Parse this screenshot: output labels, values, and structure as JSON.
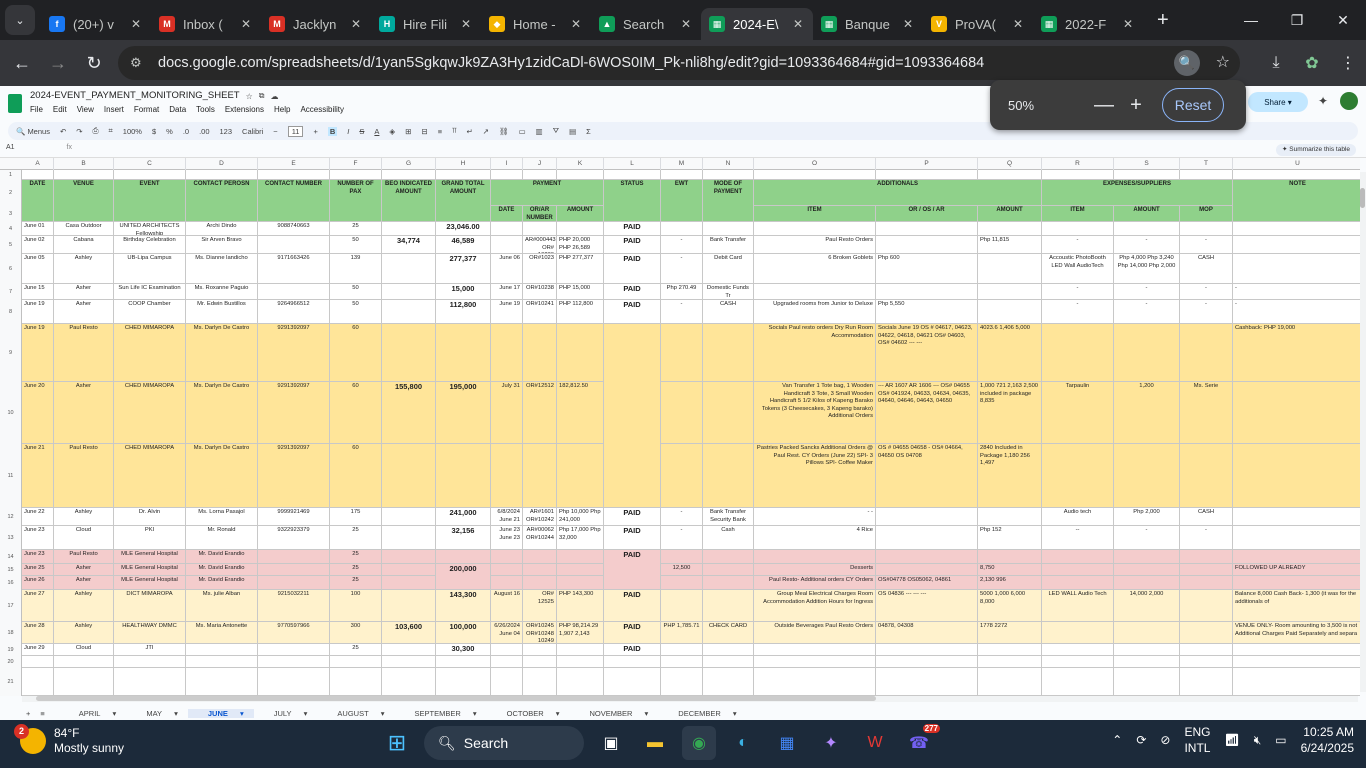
{
  "tabs": [
    {
      "label": "(20+) v",
      "color": "#1877f2",
      "icon": "f"
    },
    {
      "label": "Inbox (",
      "color": "#d93025",
      "icon": "M"
    },
    {
      "label": "Jacklyn",
      "color": "#d93025",
      "icon": "M"
    },
    {
      "label": "Hire Fili",
      "color": "#00a99d",
      "icon": "H"
    },
    {
      "label": "Home -",
      "color": "#f4b400",
      "icon": "◆"
    },
    {
      "label": "Search",
      "color": "#0f9d58",
      "icon": "▲"
    },
    {
      "label": "2024-E\\",
      "color": "#0f9d58",
      "icon": "▦",
      "active": true
    },
    {
      "label": "Banque",
      "color": "#0f9d58",
      "icon": "▦"
    },
    {
      "label": "ProVA(",
      "color": "#f4b400",
      "icon": "V"
    },
    {
      "label": "2022-F",
      "color": "#0f9d58",
      "icon": "▦"
    }
  ],
  "url": "docs.google.com/spreadsheets/d/1yan5SgkqwJk9ZA3Hy1zidCaDl-6WOS0IM_Pk-nli8hg/edit?gid=1093364684#gid=1093364684",
  "doc_title": "2024-EVENT_PAYMENT_MONITORING_SHEET",
  "menus": [
    "File",
    "Edit",
    "View",
    "Insert",
    "Format",
    "Data",
    "Tools",
    "Extensions",
    "Help",
    "Accessibility"
  ],
  "toolbar": {
    "menus_label": "Menus",
    "zoom": "100%",
    "currency": "$",
    "percent": "%",
    "dec1": ".0",
    "dec2": ".00",
    "numfmt": "123",
    "font": "Calibri",
    "size": "11",
    "bold": "B",
    "italic": "I",
    "strike": "S",
    "textcolor": "A"
  },
  "share": "Share",
  "summarize": "Summarize this table",
  "cellref": "A1",
  "fx": "fx",
  "zoom_popup": {
    "value": "50%",
    "reset": "Reset"
  },
  "col_letters": [
    "A",
    "B",
    "C",
    "D",
    "E",
    "F",
    "G",
    "H",
    "I",
    "J",
    "K",
    "L",
    "M",
    "N",
    "O",
    "P",
    "Q",
    "R",
    "S",
    "T",
    "U",
    "V"
  ],
  "row_numbers": [
    "1",
    "2",
    "3",
    "4",
    "5",
    "6",
    "7",
    "8",
    "9",
    "10",
    "11",
    "12",
    "13",
    "14",
    "15",
    "16",
    "17",
    "18",
    "19",
    "20",
    "21"
  ],
  "headers": {
    "date": "DATE",
    "venue": "VENUE",
    "event": "EVENT",
    "contact_person": "CONTACT PEROSN",
    "contact_number": "CONTACT NUMBER",
    "pax": "NUMBER OF PAX",
    "beo": "BEO INDICATED AMOUNT",
    "grand": "GRAND TOTAL AMOUNT",
    "payment": "PAYMENT",
    "status": "STATUS",
    "ewt": "EWT",
    "mop": "MODE OF PAYMENT",
    "additionals": "ADDITIONALS",
    "expenses": "EXPENSES/SUPPLIERS",
    "notes": "NOTE",
    "pay_date": "DATE",
    "or_ar": "OR/AR NUMBER",
    "pay_amount": "AMOUNT",
    "item": "ITEM",
    "or_os": "OR / OS / AR",
    "add_amount": "AMOUNT",
    "exp_item": "ITEM",
    "exp_amount": "AMOUNT",
    "exp_mop": "MOP"
  },
  "rows": [
    {
      "date": "June 01",
      "venue": "Casa Outdoor",
      "event": "UNITED ARCHITECTS Fellowship",
      "person": "Archi Dindo",
      "number": "9088740663",
      "pax": "25",
      "beo": "",
      "grand": "23,046.00",
      "pdate": "",
      "or": "",
      "pamt": "",
      "status": "PAID",
      "ewt": "",
      "mop": "",
      "item": "",
      "oros": "",
      "addamt": "",
      "eitem": "",
      "eamt": "",
      "emop": "",
      "note": ""
    },
    {
      "date": "June 02",
      "venue": "Cabana",
      "event": "Birthday Celebration",
      "person": "Sir Arven Bravo",
      "number": "",
      "pax": "50",
      "beo": "34,774",
      "grand": "46,589",
      "pdate": "",
      "or": "AR#000443 OR# 10236",
      "pamt": "PHP 20,000 PHP 26,589",
      "status": "PAID",
      "ewt": "-",
      "mop": "Bank Transfer",
      "item": "Paul Resto Orders",
      "oros": "",
      "addamt": "Php 11,815",
      "eitem": "-",
      "eamt": "-",
      "emop": "-",
      "note": ""
    },
    {
      "date": "June 05",
      "venue": "Ashley",
      "event": "UB-Lipa Campus",
      "person": "Ms. Dianne landicho",
      "number": "9171663426",
      "pax": "139",
      "beo": "",
      "grand": "277,377",
      "pdate": "June 06",
      "or": "OR#1023",
      "pamt": "PHP 277,377",
      "status": "PAID",
      "ewt": "-",
      "mop": "Debit Card",
      "item": "6 Broken Goblets",
      "oros": "Php  600",
      "addamt": "",
      "eitem": "Accoustic PhotoBooth LED Wall AudioTech",
      "eamt": "Php 4,000 Php 3,240 Php 14,000 Php 2,000",
      "emop": "CASH",
      "note": ""
    },
    {
      "date": "June 15",
      "venue": "Asher",
      "event": "Sun Life IC Examination",
      "person": "Ms. Roxanne Paguio",
      "number": "",
      "pax": "50",
      "beo": "",
      "grand": "15,000",
      "pdate": "June 17",
      "or": "OR#10238",
      "pamt": "PHP 15,000",
      "status": "PAID",
      "ewt": "Php 270.49",
      "mop": "Domestic Funds Tr",
      "item": "",
      "oros": "",
      "addamt": "",
      "eitem": "-",
      "eamt": "-",
      "emop": "-",
      "note": "-"
    },
    {
      "date": "June 19",
      "venue": "Asher",
      "event": "COOP Chamber",
      "person": "Mr. Edwin Bustillos",
      "number": "9264966512",
      "pax": "50",
      "beo": "",
      "grand": "112,800",
      "pdate": "June 19",
      "or": "OR#10241",
      "pamt": "PHP 112,800",
      "status": "PAID",
      "ewt": "-",
      "mop": "CASH",
      "item": "Upgraded rooms from Junior to Deluxe",
      "oros": "Php 5,550",
      "addamt": "",
      "eitem": "-",
      "eamt": "-",
      "emop": "-",
      "note": "-"
    },
    {
      "date": "June 19",
      "venue": "Paul Resto",
      "event": "CHED MIMAROPA",
      "person": "Ms. Darlyn De Castro",
      "number": "9291392097",
      "pax": "60",
      "beo": "",
      "grand": "",
      "pdate": "",
      "or": "",
      "pamt": "",
      "status": "",
      "ewt": "",
      "mop": "",
      "item": "Socials Paul resto orders Dry Run Room Accommodation",
      "oros": "Socials June 19 OS # 04617, 04623, 04622, 04618, 04621 OS# 04603, OS# 04602 --- ---",
      "addamt": "4023.6 1,406 5,000",
      "eitem": "",
      "eamt": "",
      "emop": "",
      "note": "Cashback: PHP 19,000"
    },
    {
      "date": "June 20",
      "venue": "Asher",
      "event": "CHED MIMAROPA",
      "person": "Ms. Darlyn De Castro",
      "number": "9291392097",
      "pax": "60",
      "beo": "155,800",
      "grand": "195,000",
      "pdate": "July 31",
      "or": "OR#12512",
      "pamt": "182,812.50",
      "status": "PAID",
      "ewt": "",
      "mop": "",
      "item": "Van Transfer 1 Tote bag, 1 Wooden Handicraft 3 Tote, 3 Small Wooden Handicraft 5 1/2 Kilos of Kapeng Barako Tokens (3 Cheesecakes, 3 Kapeng barako) Additional Orders",
      "oros": "--- AR 1607 AR 1606 --- OS# 04655 OS# 041924, 04633, 04634, 04635, 04640, 04646, 04643, 04650",
      "addamt": "1,000 721 2,163 2,500 included in package 8,835",
      "eitem": "Tarpaulin",
      "eamt": "1,200",
      "emop": "Ms. Serie",
      "note": ""
    },
    {
      "date": "June 21",
      "venue": "Paul Resto",
      "event": "CHED MIMAROPA",
      "person": "Ms. Darlyn De Castro",
      "number": "9291392097",
      "pax": "60",
      "beo": "",
      "grand": "",
      "pdate": "",
      "or": "",
      "pamt": "",
      "status": "",
      "ewt": "",
      "mop": "",
      "item": "Pastries Packed Sancks Additional Orders @ Paul Rest. CY Orders (June 22) SPI- 3 Pillows SPI- Coffee Maker",
      "oros": "OS # 04655 04658 - OS# 04664, 04650 OS 04708",
      "addamt": "2840 Included in Package 1,180 256 1,497",
      "eitem": "",
      "eamt": "",
      "emop": "",
      "note": ""
    },
    {
      "date": "June 22",
      "venue": "Ashley",
      "event": "Dr. Alvin",
      "person": "Ms. Lorna Pasajol",
      "number": "9999921469",
      "pax": "175",
      "beo": "",
      "grand": "241,000",
      "pdate": "6/8/2024 June 21",
      "or": "AR#1601 OR#10242",
      "pamt": "Php 10,000 Php 241,000",
      "status": "PAID",
      "ewt": "-",
      "mop": "Bank Transfer Security Bank",
      "item": "- -",
      "oros": "",
      "addamt": "",
      "eitem": "Audio tech",
      "eamt": "Php 2,000",
      "emop": "CASH",
      "note": ""
    },
    {
      "date": "June 23",
      "venue": "Cloud",
      "event": "PKI",
      "person": "Mr. Ronald",
      "number": "9322923379",
      "pax": "25",
      "beo": "",
      "grand": "32,156",
      "pdate": "June 23 June 23",
      "or": "AR#00062 OR#10244",
      "pamt": "Php 17,000 Php 32,000",
      "status": "PAID",
      "ewt": "-",
      "mop": "Cash",
      "item": "4 Rice",
      "oros": "",
      "addamt": "Php 152",
      "eitem": "--",
      "eamt": "-",
      "emop": "-",
      "note": ""
    },
    {
      "date": "June 23",
      "venue": "Paul Resto",
      "event": "MLE General Hospital",
      "person": "Mr. David Erandio",
      "number": "",
      "pax": "25",
      "beo": "",
      "grand": "",
      "pdate": "",
      "or": "",
      "pamt": "",
      "status": "",
      "ewt": "",
      "mop": "",
      "item": "",
      "oros": "",
      "addamt": "",
      "eitem": "",
      "eamt": "",
      "emop": "",
      "note": ""
    },
    {
      "date": "June 25",
      "venue": "Asher",
      "event": "MLE General Hospital",
      "person": "Mr. David Erandio",
      "number": "",
      "pax": "25",
      "beo": "",
      "grand": "200,000",
      "pdate": "",
      "or": "",
      "pamt": "",
      "status": "",
      "ewt": "12,500",
      "mop": "",
      "item": "Desserts",
      "oros": "",
      "addamt": "8,750",
      "eitem": "",
      "eamt": "",
      "emop": "",
      "note": "FOLLOWED UP ALREADY"
    },
    {
      "date": "June 26",
      "venue": "Asher",
      "event": "MLE General Hospital",
      "person": "Mr. David Erandio",
      "number": "",
      "pax": "25",
      "beo": "",
      "grand": "",
      "pdate": "",
      "or": "",
      "pamt": "",
      "status": "PAID",
      "ewt": "",
      "mop": "",
      "item": "Paul Resto- Additional orders CY Orders",
      "oros": "OS#04778 OS05062, 04861",
      "addamt": "2,130 996",
      "eitem": "",
      "eamt": "",
      "emop": "",
      "note": ""
    },
    {
      "date": "June 27",
      "venue": "Ashley",
      "event": "DICT MIMAROPA",
      "person": "Ms. julie Alban",
      "number": "9215032211",
      "pax": "100",
      "beo": "",
      "grand": "143,300",
      "pdate": "August 16",
      "or": "OR# 12525",
      "pamt": "PHP 143,300",
      "status": "PAID",
      "ewt": "",
      "mop": "",
      "item": "Group Meal Electrical Charges Room Accommodation Addition Hours for Ingress",
      "oros": "OS 04836 --- --- ---",
      "addamt": "5000 1,000 6,000 8,000",
      "eitem": "LED WALL Audio Tech",
      "eamt": "14,000 2,000",
      "emop": "",
      "note": "Balance 8,000 Cash Back- 1,300 (it was for the additionals of"
    },
    {
      "date": "June 28",
      "venue": "Ashley",
      "event": "HEALTHWAY DMMC",
      "person": "Ms. Maria Antonette",
      "number": "9770597966",
      "pax": "300",
      "beo": "103,600",
      "grand": "100,000",
      "pdate": "6/26/2024 June 04",
      "or": "OR#10245 OR#10248 10249",
      "pamt": "PHP 98,214.29 1,907 2,143",
      "status": "PAID",
      "ewt": "PHP 1,785.71",
      "mop": "CHECK CARD",
      "item": "Outside Beverages Paul Resto Orders",
      "oros": "04878, 04308",
      "addamt": "1778 2272",
      "eitem": "",
      "eamt": "",
      "emop": "",
      "note": "VENUE ONLY- Room amounting to 3,500 is not Additional Charges Paid Separately and separa"
    },
    {
      "date": "June 29",
      "venue": "Cloud",
      "event": "JTI",
      "person": "",
      "number": "",
      "pax": "25",
      "beo": "",
      "grand": "30,300",
      "pdate": "",
      "or": "",
      "pamt": "",
      "status": "PAID",
      "ewt": "",
      "mop": "",
      "item": "",
      "oros": "",
      "addamt": "",
      "eitem": "",
      "eamt": "",
      "emop": "",
      "note": ""
    }
  ],
  "sheet_tabs": [
    "APRIL",
    "MAY",
    "JUNE",
    "JULY",
    "AUGUST",
    "SEPTEMBER",
    "OCTOBER",
    "NOVEMBER",
    "DECEMBER"
  ],
  "active_sheet": "JUNE",
  "taskbar": {
    "temp": "84°F",
    "weather": "Mostly sunny",
    "badge": "2",
    "search": "Search",
    "lang1": "ENG",
    "lang2": "INTL",
    "time": "10:25 AM",
    "date": "6/24/2025",
    "viber_badge": "277"
  }
}
